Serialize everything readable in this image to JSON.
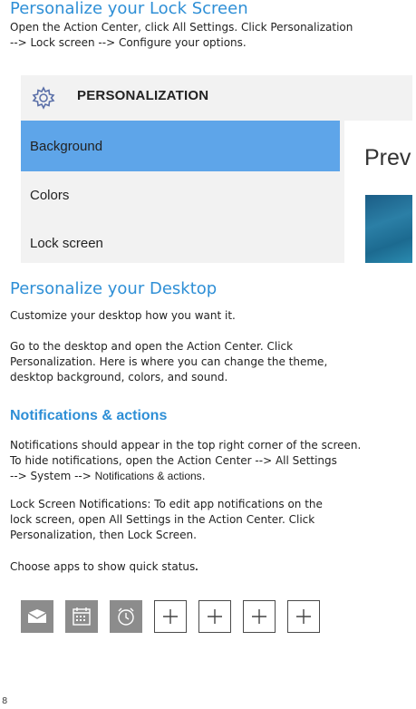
{
  "section1": {
    "title": "Personalize your Lock Screen",
    "body": "Open the Action Center, click All Settings. Click Personalization\n --> Lock screen --> Configure your options."
  },
  "screenshot": {
    "header": "PERSONALIZATION",
    "menu": [
      "Background",
      "Colors",
      "Lock screen"
    ],
    "selected": "Background",
    "preview_label": "Previ",
    "accent": "#5ea5e9"
  },
  "section2": {
    "title": "Personalize your Desktop",
    "p1": "Customize your desktop how you want it.",
    "p2": "Go to the desktop and open the Action Center. Click\nPersonalization. Here is where you can change the theme,\ndesktop background, colors, and sound."
  },
  "section3": {
    "title": "Notifications & actions",
    "p1_lead": "Notifications should appear in the top right corner of the screen.\nTo hide notifications, open the Action Center --> All Settings\n--> System --> ",
    "p1_link": "Notifications & actions",
    "p1_end": ".",
    "p2": "Lock Screen Notifications: To edit app notifications on the\nlock screen, open All Settings in the Action Center. Click\nPersonalization, then Lock Screen.",
    "p3_lead": "Choose apps to show quick status",
    "p3_end": "."
  },
  "quick_status": {
    "tiles": [
      {
        "icon": "mail-icon",
        "kind": "app"
      },
      {
        "icon": "calendar-icon",
        "kind": "app"
      },
      {
        "icon": "alarm-icon",
        "kind": "app"
      },
      {
        "icon": "plus-icon",
        "kind": "empty"
      },
      {
        "icon": "plus-icon",
        "kind": "empty"
      },
      {
        "icon": "plus-icon",
        "kind": "empty"
      },
      {
        "icon": "plus-icon",
        "kind": "empty"
      }
    ]
  },
  "page_number": "8",
  "colors": {
    "heading": "#2e8fd6",
    "tile_fill": "#8c8c8c"
  }
}
